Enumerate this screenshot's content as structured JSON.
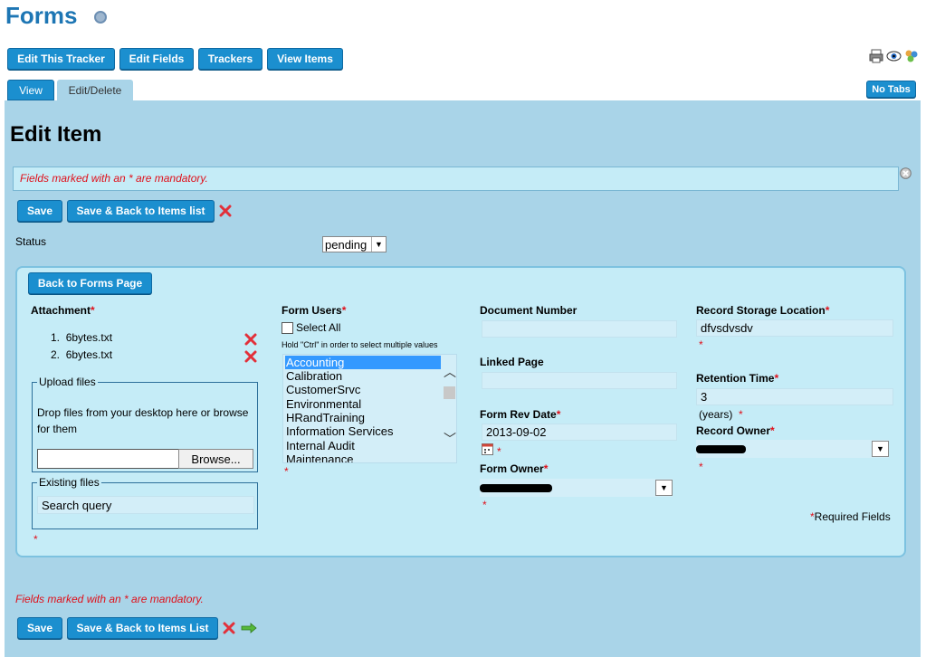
{
  "page": {
    "title": "Forms"
  },
  "toolbar": {
    "buttons": [
      "Edit This Tracker",
      "Edit Fields",
      "Trackers",
      "View Items"
    ],
    "no_tabs": "No Tabs"
  },
  "tabs": [
    "View",
    "Edit/Delete"
  ],
  "edit": {
    "heading": "Edit Item",
    "mandatory_note": "Fields marked with an * are mandatory.",
    "save": "Save",
    "save_back_top": "Save & Back to Items list",
    "save_back_bottom": "Save & Back to Items List",
    "status_label": "Status",
    "status_value": "pending",
    "back_button": "Back to Forms Page",
    "required_fields": "Required Fields"
  },
  "attachment": {
    "label": "Attachment",
    "files": [
      "6bytes.txt",
      "6bytes.txt"
    ],
    "upload_legend": "Upload files",
    "drop_text": "Drop files from your desktop here or browse for them",
    "browse": "Browse...",
    "existing_legend": "Existing files",
    "search_placeholder": "Search query"
  },
  "form_users": {
    "label": "Form Users",
    "select_all": "Select All",
    "hint": "Hold \"Ctrl\" in order to select multiple values",
    "options": [
      "Accounting",
      "Calibration",
      "CustomerSrvc",
      "Environmental",
      "HRandTraining",
      "Information Services",
      "Internal Audit",
      "Maintenance"
    ],
    "selected_index": 0
  },
  "document": {
    "number_label": "Document Number",
    "linked_label": "Linked Page",
    "rev_date_label": "Form Rev Date",
    "rev_date_value": "2013-09-02",
    "owner_label": "Form Owner"
  },
  "record": {
    "storage_label": "Record Storage Location",
    "storage_value": "dfvsdvsdv",
    "retention_label": "Retention Time",
    "retention_value": "3",
    "retention_unit": "(years)",
    "owner_label": "Record Owner"
  },
  "colors": {
    "accent": "#1b8fcf",
    "panel": "#a9d4e8",
    "inner_panel": "#c5ecf7",
    "title": "#1d76b4",
    "required": "#e0101a"
  }
}
